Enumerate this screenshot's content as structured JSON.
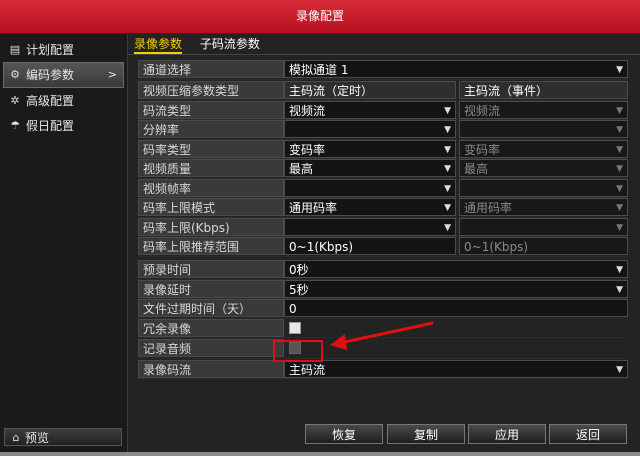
{
  "window": {
    "title": "录像配置"
  },
  "sidebar": {
    "items": [
      {
        "label": "计划配置",
        "icon": "calendar-icon"
      },
      {
        "label": "编码参数",
        "icon": "gear-icon",
        "active": true
      },
      {
        "label": "高级配置",
        "icon": "settings-icon"
      },
      {
        "label": "假日配置",
        "icon": "umbrella-icon"
      }
    ],
    "preview_label": "预览"
  },
  "tabs": [
    {
      "label": "录像参数",
      "active": true
    },
    {
      "label": "子码流参数",
      "active": false
    }
  ],
  "channel": {
    "label": "通道选择",
    "value": "模拟通道 1"
  },
  "header": {
    "label": "视频压缩参数类型",
    "col1": "主码流（定时）",
    "col2": "主码流（事件）"
  },
  "params": [
    {
      "label": "码流类型",
      "col1": "视频流",
      "col2": "视频流"
    },
    {
      "label": "分辨率",
      "col1": "",
      "col2": ""
    },
    {
      "label": "码率类型",
      "col1": "变码率",
      "col2": "变码率"
    },
    {
      "label": "视频质量",
      "col1": "最高",
      "col2": "最高"
    },
    {
      "label": "视频帧率",
      "col1": "",
      "col2": ""
    },
    {
      "label": "码率上限模式",
      "col1": "通用码率",
      "col2": "通用码率"
    },
    {
      "label": "码率上限(Kbps)",
      "col1": "",
      "col2": ""
    },
    {
      "label": "码率上限推荐范围",
      "col1": "0~1(Kbps)",
      "col2": "0~1(Kbps)"
    }
  ],
  "record": {
    "prerecord": {
      "label": "预录时间",
      "value": "0秒"
    },
    "delay": {
      "label": "录像延时",
      "value": "5秒"
    },
    "expire": {
      "label": "文件过期时间（天）",
      "value": "0"
    },
    "redundant": {
      "label": "冗余录像",
      "checked": false
    },
    "audio": {
      "label": "记录音频",
      "enabled": false
    },
    "stream": {
      "label": "录像码流",
      "value": "主码流"
    }
  },
  "buttons": {
    "restore": "恢复",
    "copy": "复制",
    "apply": "应用",
    "back": "返回"
  },
  "colors": {
    "title_bar": "#c8192b",
    "active_tab": "#f5d000",
    "annotation": "#e01010"
  }
}
